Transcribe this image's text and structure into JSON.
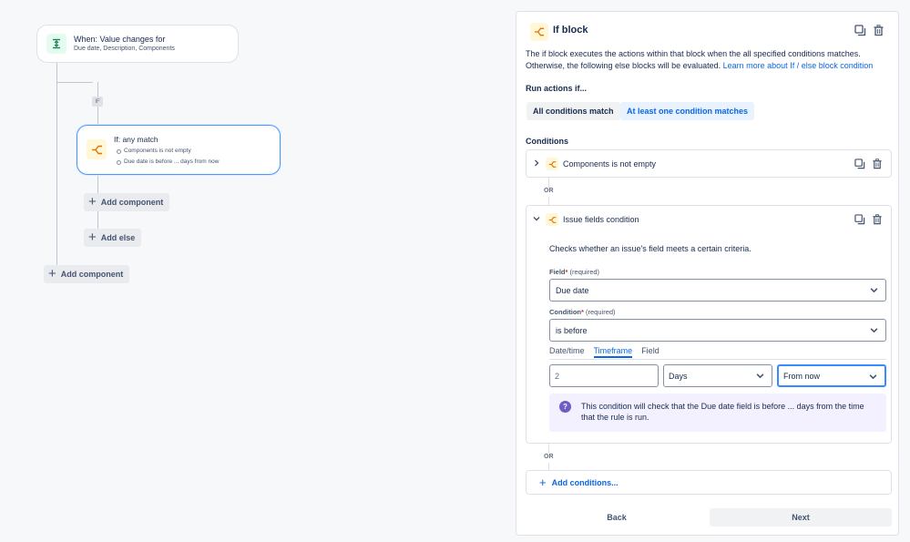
{
  "canvas": {
    "trigger": {
      "title": "When: Value changes for",
      "subtitle": "Due date, Description, Components"
    },
    "if_tag": "IF",
    "if_block": {
      "title": "If: any match",
      "items": [
        "Components is not empty",
        "Due date is before ... days from now"
      ]
    },
    "add_component_inner": "Add component",
    "add_else": "Add else",
    "add_component_outer": "Add component"
  },
  "panel": {
    "title": "If block",
    "description": "The if block executes the actions within that block when the all specified conditions matches. Otherwise, the following else blocks will be evaluated.",
    "learn_more": "Learn more about If / else block condition",
    "run_label": "Run actions if...",
    "run_options": [
      "All conditions match",
      "At least one condition matches"
    ],
    "run_selected": "At least one condition matches",
    "conditions_label": "Conditions",
    "conditions": [
      {
        "title": "Components is not empty",
        "expanded": false
      },
      {
        "title": "Issue fields condition",
        "expanded": true
      }
    ],
    "or_label": "OR",
    "issue_condition": {
      "checks_text": "Checks whether an issue's field meets a certain criteria.",
      "field_label": "Field",
      "field_required": "(required)",
      "field_value": "Due date",
      "condition_label": "Condition",
      "condition_required": "(required)",
      "condition_value": "is before",
      "tabs": [
        "Date/time",
        "Timeframe",
        "Field"
      ],
      "active_tab": "Timeframe",
      "amount_value": "2",
      "unit_value": "Days",
      "direction_value": "From now",
      "info_text": "This condition will check that the Due date field is before ... days from the time that the rule is run."
    },
    "add_conditions": "Add conditions...",
    "back_label": "Back",
    "next_label": "Next"
  },
  "colors": {
    "accent": "#0c66e4",
    "branch_icon": "#e2740f",
    "trigger_icon": "#1f845a",
    "info_icon": "#6e5dc6"
  }
}
